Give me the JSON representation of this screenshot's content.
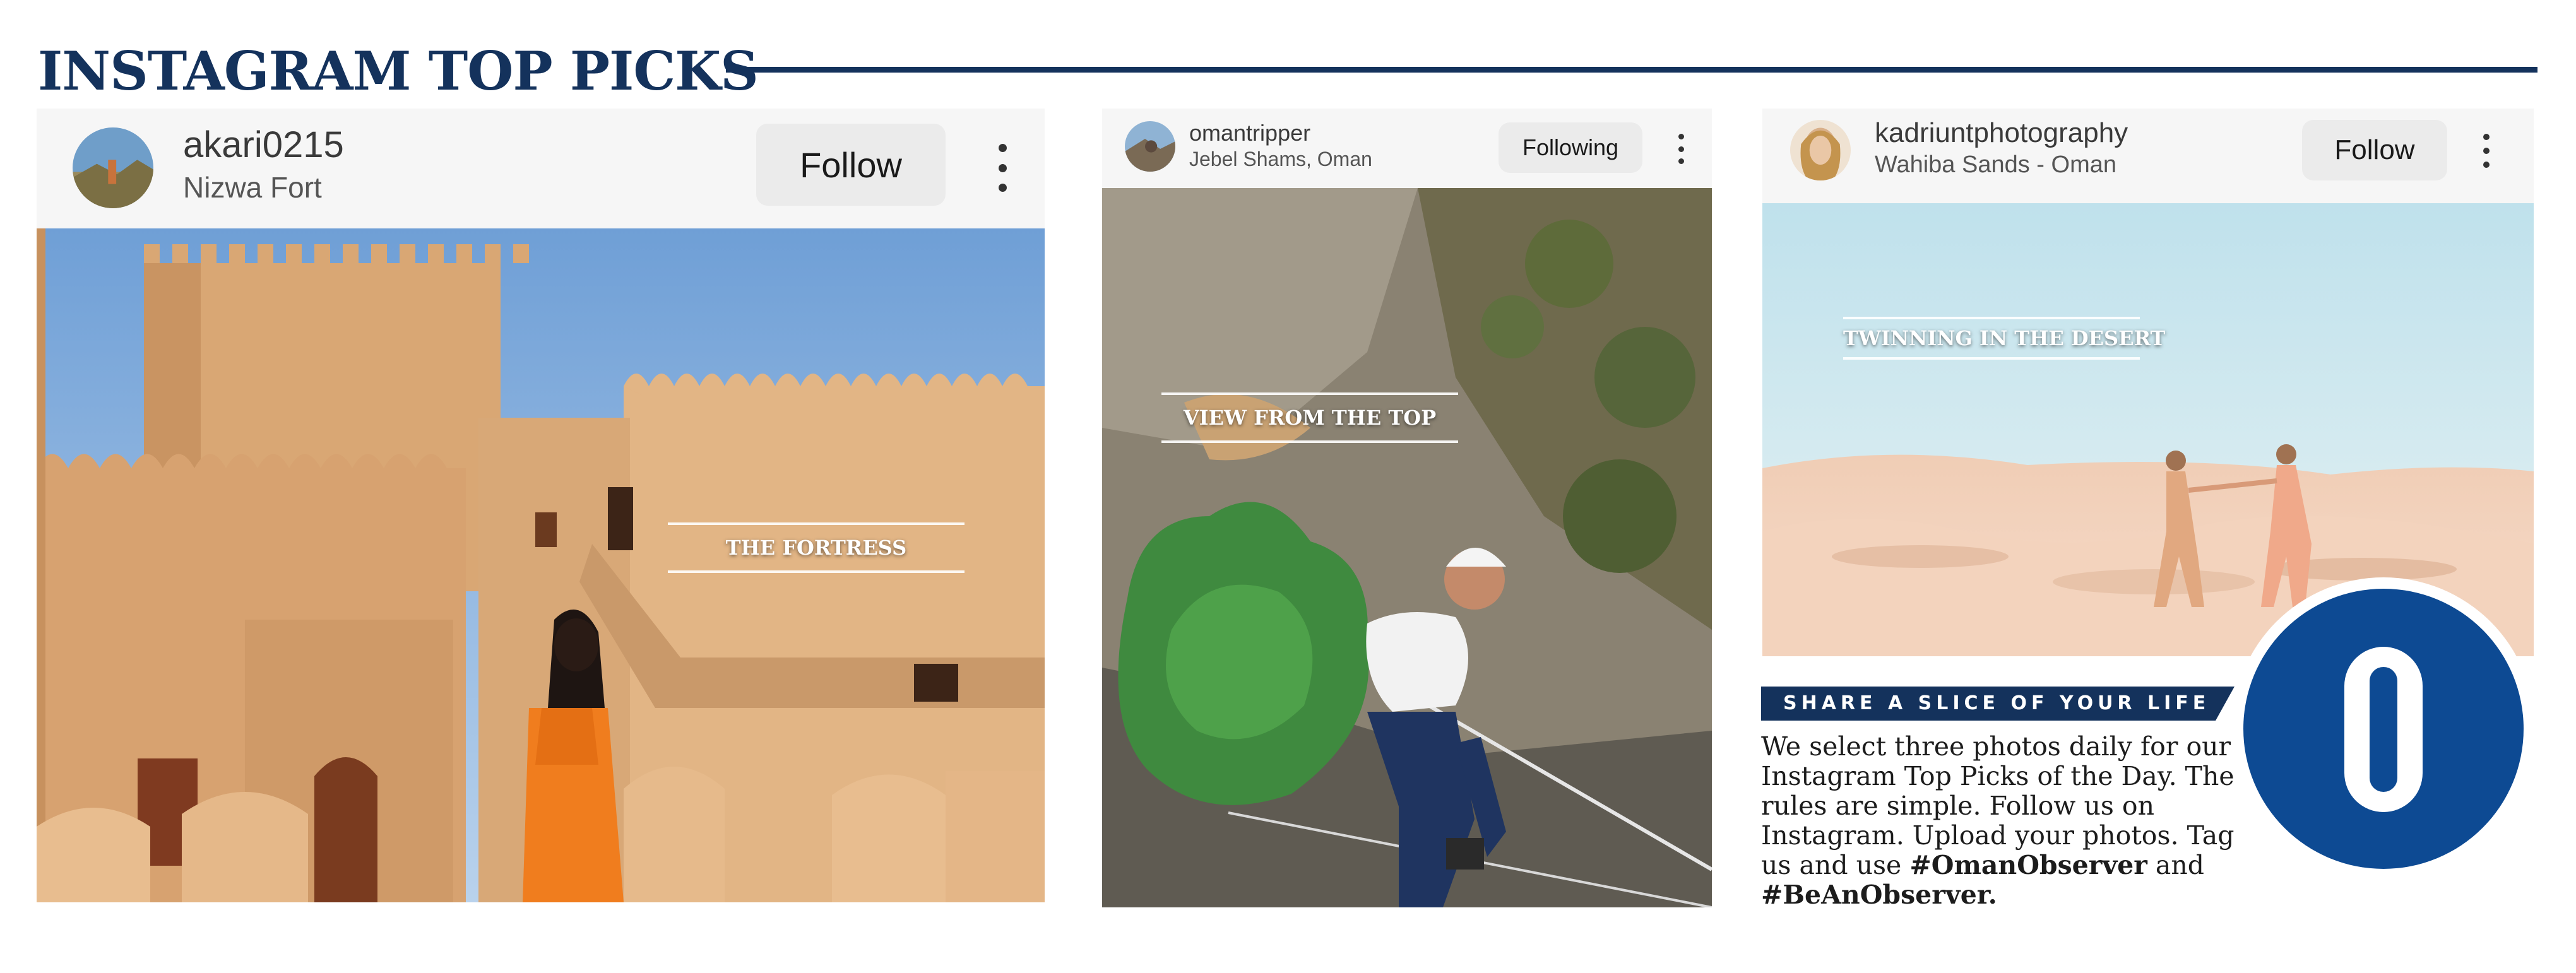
{
  "page": {
    "title": "INSTAGRAM TOP PICKS"
  },
  "posts": [
    {
      "username": "akari0215",
      "location": "Nizwa Fort",
      "button": "Follow",
      "caption": "THE FORTRESS"
    },
    {
      "username": "omantripper",
      "location": "Jebel Shams, Oman",
      "button": "Following",
      "caption": "VIEW FROM THE TOP"
    },
    {
      "username": "kadriuntphotography",
      "location": "Wahiba Sands - Oman",
      "button": "Follow",
      "caption": "TWINNING IN THE DESERT"
    }
  ],
  "info": {
    "banner": "SHARE A SLICE OF YOUR LIFE",
    "text_lead": "We select three photos daily for our Instagram Top Picks of the Day. The rules are simple. Follow us on Instagram. Upload your photos. Tag us and use",
    "hashtag1": "#OmanObserver",
    "text_and": "and",
    "hashtag2": "#BeAnObserver."
  },
  "icons": {
    "menu": "more-vertical-icon",
    "logo": "oman-observer-logo"
  },
  "colors": {
    "brand_navy": "#14325c",
    "logo_blue": "#0d4a93"
  }
}
